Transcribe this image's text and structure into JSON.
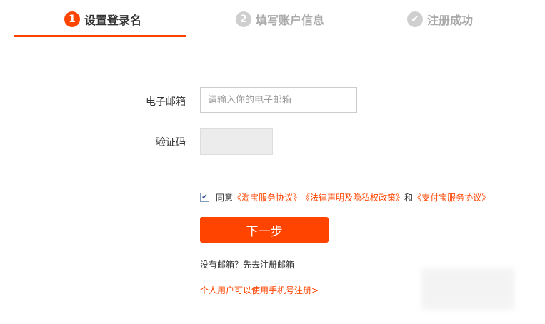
{
  "steps": [
    {
      "number": "1",
      "label": "设置登录名",
      "state": "active"
    },
    {
      "number": "2",
      "label": "填写账户信息",
      "state": "inactive"
    },
    {
      "number": "✔",
      "label": "注册成功",
      "state": "inactive"
    }
  ],
  "form": {
    "email_label": "电子邮箱",
    "email_placeholder": "请输入你的电子邮箱",
    "email_value": "",
    "code_label": "验证码",
    "code_value": ""
  },
  "agreement": {
    "checked": true,
    "prefix": "同意",
    "link1": "《淘宝服务协议》",
    "link2": "《法律声明及隐私权政策》",
    "conjunction": "和",
    "link3": "《支付宝服务协议》"
  },
  "next_button": "下一步",
  "no_email_text": "没有邮箱？先去注册邮箱",
  "phone_link": "个人用户可以使用手机号注册>",
  "colors": {
    "accent": "#ff4400",
    "inactive_step": "#cfcfcf",
    "border": "#cccccc"
  }
}
